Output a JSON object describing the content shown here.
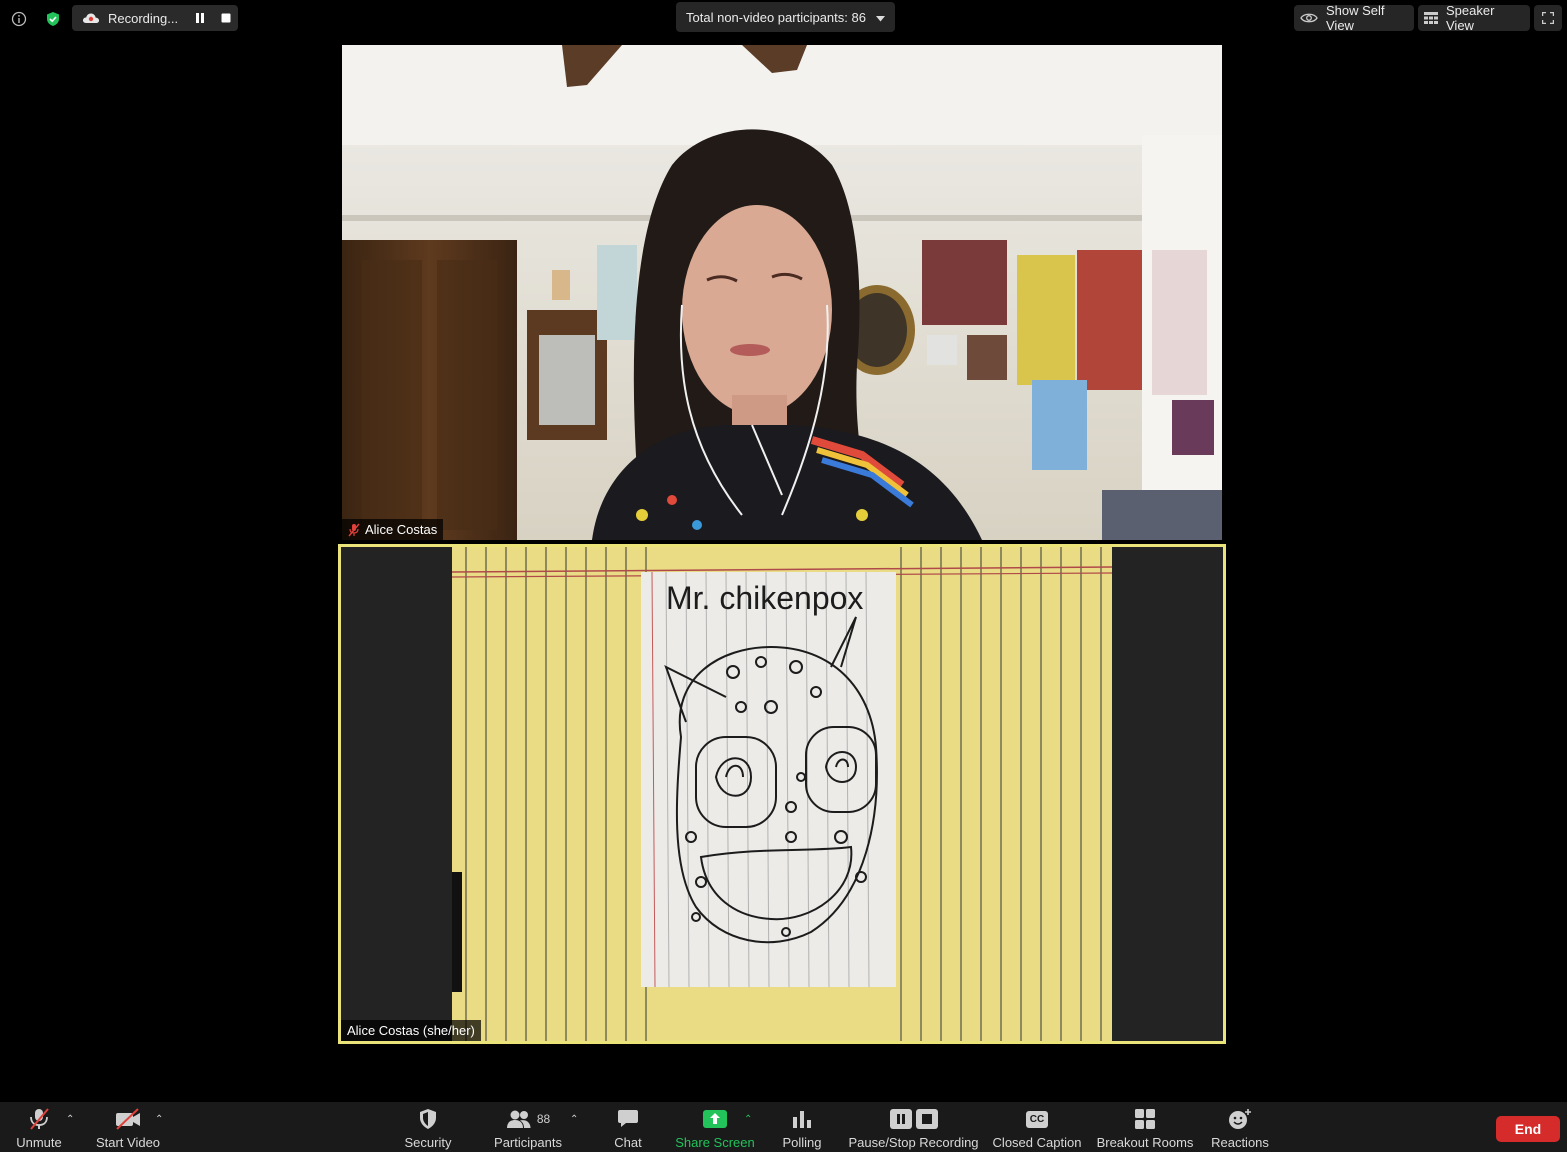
{
  "top_bar": {
    "recording_label": "Recording...",
    "participants_summary": "Total non-video participants: 86",
    "show_self_view": "Show Self View",
    "speaker_view": "Speaker View"
  },
  "videos": [
    {
      "name": "Alice Costas",
      "muted": true
    },
    {
      "name": "Alice Costas (she/her)",
      "active_speaker": true
    }
  ],
  "drawing": {
    "title": "Mr. chikenpox"
  },
  "toolbar": {
    "unmute": "Unmute",
    "start_video": "Start Video",
    "security": "Security",
    "participants": "Participants",
    "participants_count": "88",
    "chat": "Chat",
    "share_screen": "Share Screen",
    "polling": "Polling",
    "pause_stop_recording": "Pause/Stop Recording",
    "closed_caption": "Closed Caption",
    "closed_caption_badge": "CC",
    "breakout_rooms": "Breakout Rooms",
    "reactions": "Reactions",
    "end": "End"
  },
  "colors": {
    "active_speaker_border": "#e9e37a",
    "share_screen": "#22c35a",
    "end_button": "#d52b2b",
    "security_shield": "#22c35a"
  }
}
